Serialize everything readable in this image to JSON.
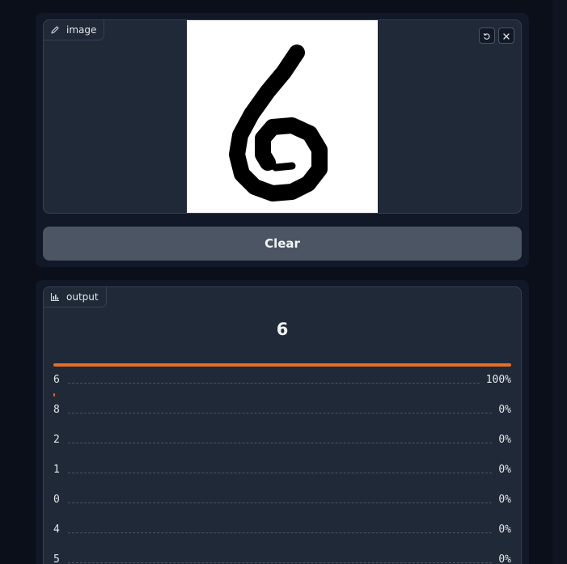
{
  "input_panel": {
    "label": "image",
    "clear_label": "Clear"
  },
  "output_panel": {
    "label": "output",
    "prediction": "6",
    "confidences": [
      {
        "label": "6",
        "percent": "100%",
        "fraction": 1.0
      },
      {
        "label": "8",
        "percent": "0%",
        "fraction": 0.002
      },
      {
        "label": "2",
        "percent": "0%",
        "fraction": 0.0
      },
      {
        "label": "1",
        "percent": "0%",
        "fraction": 0.0
      },
      {
        "label": "0",
        "percent": "0%",
        "fraction": 0.0
      },
      {
        "label": "4",
        "percent": "0%",
        "fraction": 0.0
      },
      {
        "label": "5",
        "percent": "0%",
        "fraction": 0.0
      }
    ]
  },
  "colors": {
    "accent_bar": "#ea6d22",
    "background": "#0b0f19",
    "block": "#1f2937",
    "button": "#4b5563"
  },
  "icons": {
    "image_label": "pencil-icon",
    "output_label": "bar-chart-icon",
    "undo": "undo-icon",
    "close": "close-icon"
  }
}
